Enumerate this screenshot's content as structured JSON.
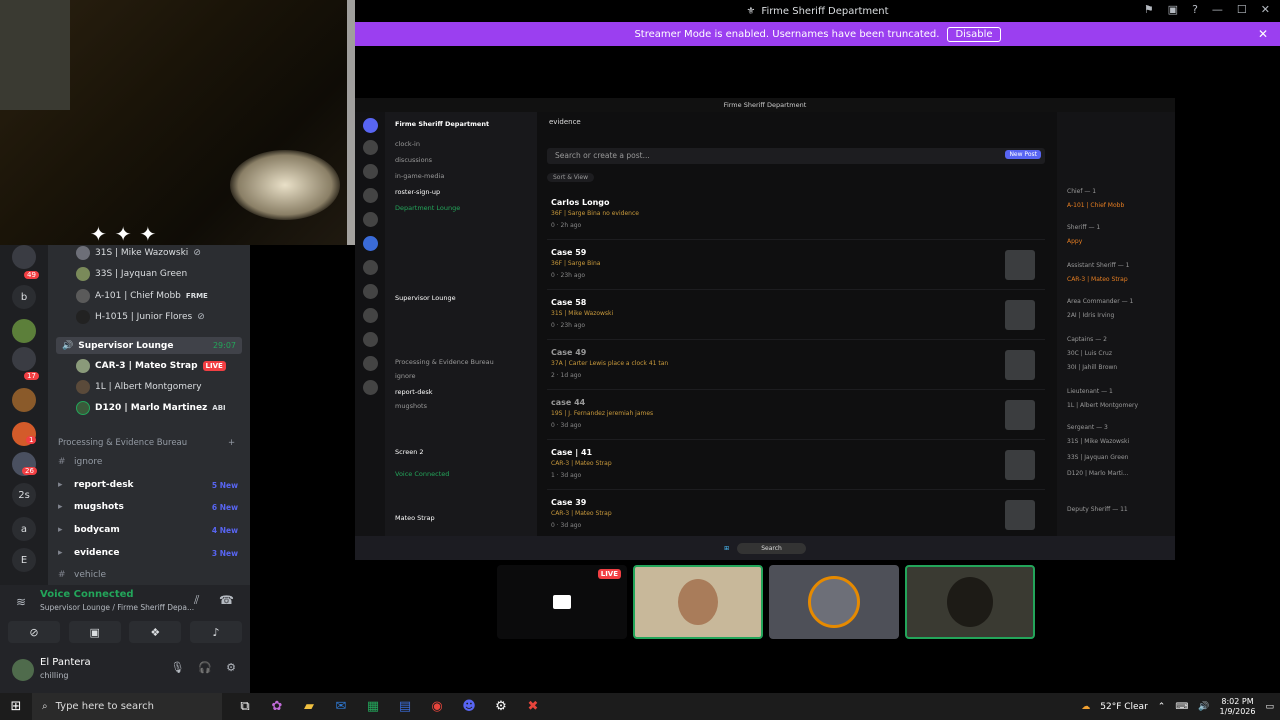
{
  "window": {
    "title": "Firme Sheriff Department"
  },
  "banner": {
    "text": "Streamer Mode is enabled. Usernames have been truncated.",
    "button": "Disable"
  },
  "rail": {
    "labels": [
      "b",
      "2s",
      "a",
      "E"
    ],
    "badges": [
      "49",
      "17",
      "1",
      "26"
    ]
  },
  "voice_users_top": [
    {
      "name": "31S | Mike Wazowski"
    },
    {
      "name": "33S | Jayquan Green"
    },
    {
      "name": "A-101 | Chief Mobb",
      "tag": "FRME"
    },
    {
      "name": "H-1015 | Junior Flores"
    }
  ],
  "supervisor_lounge": {
    "name": "Supervisor Lounge",
    "time": "29:07",
    "users": [
      {
        "name": "CAR-3 | Mateo Strap",
        "live": "LIVE"
      },
      {
        "name": "1L | Albert Montgomery"
      },
      {
        "name": "D120 | Marlo Martinez",
        "tag": "ABI"
      }
    ]
  },
  "category": {
    "name": "Processing & Evidence Bureau",
    "plus": "+"
  },
  "channels": [
    {
      "name": "ignore",
      "new": ""
    },
    {
      "name": "report-desk",
      "new": "5 New"
    },
    {
      "name": "mugshots",
      "new": "6 New"
    },
    {
      "name": "bodycam",
      "new": "4 New"
    },
    {
      "name": "evidence",
      "new": "3 New"
    },
    {
      "name": "vehicle",
      "new": ""
    }
  ],
  "voice_panel": {
    "status": "Voice Connected",
    "location": "Supervisor Lounge / Firme Sheriff Depa..."
  },
  "user": {
    "name": "El Pantera",
    "status": "chilling"
  },
  "stream": {
    "title": "Firme Sheriff Department",
    "server": "Firme Sheriff Department",
    "channels": [
      "clock-in",
      "discussions",
      "in-game-media",
      "roster-sign-up",
      "Department Lounge",
      "Supervisor Lounge",
      "Processing & Evidence Bureau",
      "ignore",
      "report-desk",
      "mugshots"
    ],
    "screen_label": "Screen 2",
    "voice": "Voice Connected",
    "user": "Mateo Strap",
    "forum": "evidence",
    "search": "Search or create a post...",
    "new_post": "New Post",
    "sort": "Sort & View",
    "posts": [
      {
        "title": "Carlos Longo",
        "author": "36F | Sarge Bina  no evidence",
        "meta": "0 · 2h ago"
      },
      {
        "title": "Case 59",
        "author": "36F | Sarge Bina",
        "meta": "0 · 23h ago"
      },
      {
        "title": "Case 58",
        "author": "31S | Mike Wazowski",
        "meta": "0 · 23h ago"
      },
      {
        "title": "Case 49",
        "author": "37A | Carter Lewis  place a clock 41 tan",
        "meta": "2 · 1d ago"
      },
      {
        "title": "case 44",
        "author": "19S | J. Fernandez  jeremiah james",
        "meta": "0 · 3d ago"
      },
      {
        "title": "Case | 41",
        "author": "CAR-3 | Mateo Strap",
        "meta": "1 · 3d ago"
      },
      {
        "title": "Case 39",
        "author": "CAR-3 | Mateo Strap",
        "meta": "0 · 3d ago"
      }
    ],
    "members": [
      "Chief — 1",
      "A-101 | Chief Mobb",
      "Sheriff — 1",
      "Appy",
      "Assistant Sheriff — 1",
      "CAR-3 | Mateo Strap",
      "Area Commander — 1",
      "2AI | Idris Irving",
      "Captains — 2",
      "30C | Luis Cruz",
      "30I | Jahill Brown",
      "Lieutenant — 1",
      "1L | Albert Montgomery",
      "Sergeant — 3",
      "31S | Mike Wazowski",
      "33S | Jayquan Green",
      "D120 | Marlo Marti...",
      "Deputy Sheriff — 11"
    ],
    "task_search": "Search"
  },
  "tiles": {
    "live": "LIVE"
  },
  "taskbar": {
    "search": "Type here to search",
    "weather": "52°F  Clear",
    "time": "8:02 PM",
    "date": "1/9/2026"
  }
}
